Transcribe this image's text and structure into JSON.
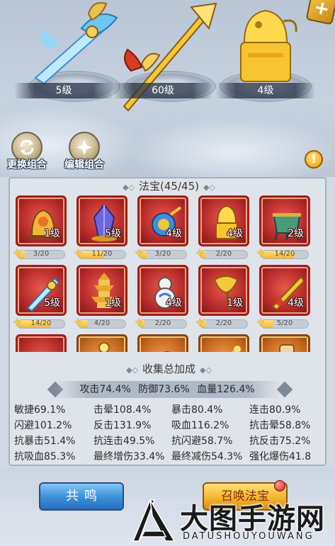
{
  "colors": {
    "card_red": "#b62a2a",
    "card_orange": "#c4661e",
    "progress_fill": "#f2b735",
    "button_blue": "#3b8ed8",
    "button_gold": "#f3b52d"
  },
  "showcase": {
    "items": [
      {
        "icon": "jade-sword-icon",
        "level": "5级"
      },
      {
        "icon": "golden-spear-icon",
        "level": "60级"
      },
      {
        "icon": "golden-seal-icon",
        "level": "4级"
      }
    ]
  },
  "actions": {
    "swap_label": "更换组合",
    "edit_label": "编辑组合",
    "warning_glyph": "!",
    "corner_glyph": "+"
  },
  "collection": {
    "title": "法宝(45/45)",
    "title_deco": "◆◇",
    "items": [
      {
        "icon": "golden-bell-icon",
        "color": "red",
        "level": "1级",
        "progress": "3/20",
        "fill": 0.15
      },
      {
        "icon": "purple-crystal-icon",
        "color": "red",
        "level": "5级",
        "progress": "11/20",
        "fill": 0.55
      },
      {
        "icon": "blue-gourd-icon",
        "color": "red",
        "level": "4级",
        "progress": "3/20",
        "fill": 0.15
      },
      {
        "icon": "golden-seal-icon",
        "color": "red",
        "level": "4级",
        "progress": "2/20",
        "fill": 0.1
      },
      {
        "icon": "bronze-cauldron-icon",
        "color": "red",
        "level": "2级",
        "progress": "14/20",
        "fill": 0.7
      },
      {
        "icon": "jade-sword-icon",
        "color": "red",
        "level": "5级",
        "progress": "14/20",
        "fill": 0.7
      },
      {
        "icon": "pagoda-icon",
        "color": "red",
        "level": "1级",
        "progress": "4/20",
        "fill": 0.2
      },
      {
        "icon": "gourd-icon",
        "color": "red",
        "level": "4级",
        "progress": "2/20",
        "fill": 0.1
      },
      {
        "icon": "golden-axe-icon",
        "color": "red",
        "level": "1级",
        "progress": "2/20",
        "fill": 0.1
      },
      {
        "icon": "golden-blade-icon",
        "color": "red",
        "level": "4级",
        "progress": "5/20",
        "fill": 0.25
      },
      {
        "icon": "golden-bowl-icon",
        "color": "red",
        "level": "",
        "progress": "",
        "fill": 0
      },
      {
        "icon": "golden-staff-icon",
        "color": "orange",
        "level": "",
        "progress": "",
        "fill": 0
      },
      {
        "icon": "purple-claw-icon",
        "color": "orange",
        "level": "",
        "progress": "",
        "fill": 0
      },
      {
        "icon": "golden-rod-icon",
        "color": "orange",
        "level": "",
        "progress": "",
        "fill": 0
      },
      {
        "icon": "scroll-icon",
        "color": "orange",
        "level": "",
        "progress": "",
        "fill": 0
      }
    ]
  },
  "bonus": {
    "title": "收集总加成",
    "highlight": [
      "攻击74.4%",
      "防御73.6%",
      "血量126.4%"
    ],
    "rows": [
      [
        "敏捷69.1%",
        "击晕108.4%",
        "暴击80.4%",
        "连击80.9%"
      ],
      [
        "闪避101.2%",
        "反击131.9%",
        "吸血116.2%",
        "抗击晕58.8%"
      ],
      [
        "抗暴击51.4%",
        "抗连击49.5%",
        "抗闪避58.7%",
        "抗反击75.2%"
      ],
      [
        "抗吸血85.3%",
        "最终增伤33.4%",
        "最终减伤54.3%",
        "强化爆伤41.8"
      ]
    ]
  },
  "buttons": {
    "resonance": "共鸣",
    "summon": "召唤法宝"
  },
  "watermark": {
    "title": "大图手游网",
    "subtitle": "DATUSHOUYOUWANG"
  }
}
